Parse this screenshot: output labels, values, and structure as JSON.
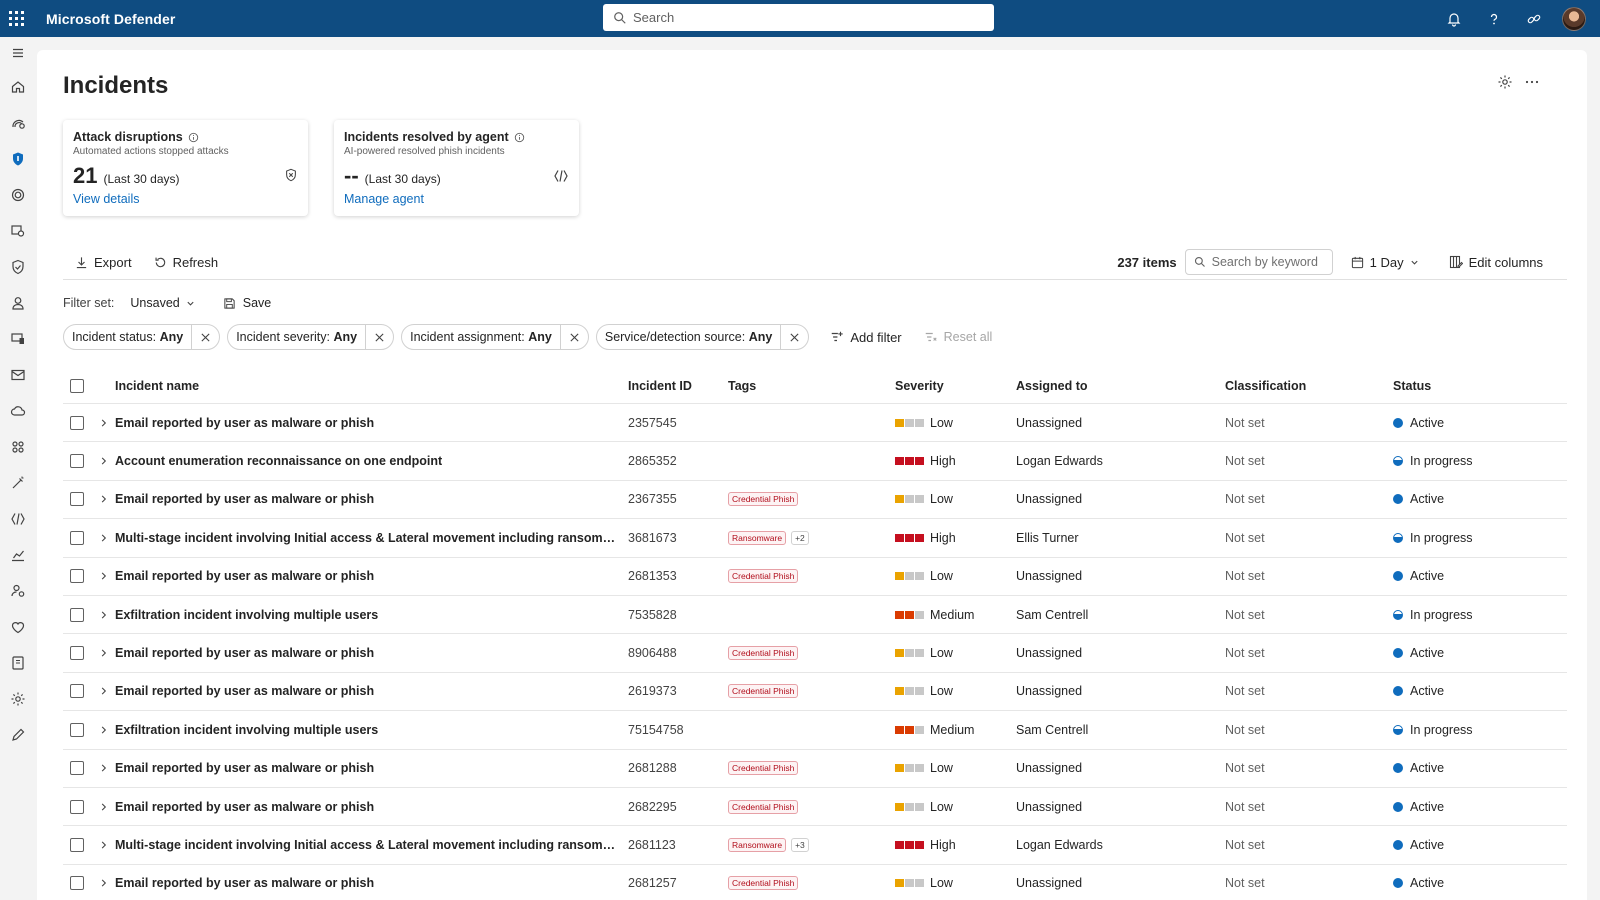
{
  "app": {
    "title": "Microsoft Defender",
    "search_placeholder": "Search"
  },
  "nav_icons": [
    "menu-icon",
    "home-icon",
    "incidents-icon",
    "shield-icon",
    "threat-intel-icon",
    "hunting-icon",
    "protection-icon",
    "identity-icon",
    "endpoint-icon",
    "email-icon",
    "cloud-icon",
    "apps-icon",
    "magic-icon",
    "agent-icon",
    "reports-icon",
    "permissions-icon",
    "health-icon",
    "learning-icon",
    "settings-icon",
    "edit-icon"
  ],
  "page": {
    "title": "Incidents"
  },
  "cards": {
    "attack": {
      "title": "Attack disruptions",
      "subtitle": "Automated actions stopped attacks",
      "value": "21",
      "period": "(Last 30 days)",
      "link": "View details"
    },
    "agent": {
      "title": "Incidents resolved by agent",
      "subtitle": "AI-powered resolved phish incidents",
      "value": "--",
      "period": "(Last 30 days)",
      "link": "Manage agent"
    }
  },
  "toolbar": {
    "export_label": "Export",
    "refresh_label": "Refresh",
    "items_count": "237 items",
    "keyword_placeholder": "Search by keyword",
    "day_label": "1 Day",
    "edit_columns_label": "Edit columns"
  },
  "filterset": {
    "label": "Filter set:",
    "value": "Unsaved",
    "save_label": "Save"
  },
  "filters": [
    {
      "name": "Incident status:",
      "value": "Any"
    },
    {
      "name": "Incident severity:",
      "value": "Any"
    },
    {
      "name": "Incident assignment:",
      "value": "Any"
    },
    {
      "name": "Service/detection source:",
      "value": "Any"
    }
  ],
  "add_filter_label": "Add filter",
  "reset_all_label": "Reset all",
  "table": {
    "columns": {
      "name": "Incident name",
      "id": "Incident ID",
      "tags": "Tags",
      "severity": "Severity",
      "assigned": "Assigned to",
      "classification": "Classification",
      "status": "Status"
    },
    "rows": [
      {
        "name": "Email reported by user as malware or phish",
        "id": "2357545",
        "tag": "",
        "more": "",
        "severity": "Low",
        "assigned": "Unassigned",
        "classification": "Not set",
        "status": "Active"
      },
      {
        "name": "Account enumeration reconnaissance on one endpoint",
        "id": "2865352",
        "tag": "",
        "more": "",
        "severity": "High",
        "assigned": "Logan Edwards",
        "classification": "Not set",
        "status": "In progress"
      },
      {
        "name": "Email reported by user as malware or phish",
        "id": "2367355",
        "tag": "Credential Phish",
        "more": "",
        "severity": "Low",
        "assigned": "Unassigned",
        "classification": "Not set",
        "status": "Active"
      },
      {
        "name": "Multi-stage incident involving Initial access & Lateral movement including ransomware on mu...",
        "id": "3681673",
        "tag": "Ransomware",
        "more": "+2",
        "severity": "High",
        "assigned": "Ellis Turner",
        "classification": "Not set",
        "status": "In progress"
      },
      {
        "name": "Email reported by user as malware or phish",
        "id": "2681353",
        "tag": "Credential Phish",
        "more": "",
        "severity": "Low",
        "assigned": "Unassigned",
        "classification": "Not set",
        "status": "Active"
      },
      {
        "name": "Exfiltration incident involving multiple users",
        "id": "7535828",
        "tag": "",
        "more": "",
        "severity": "Medium",
        "assigned": "Sam Centrell",
        "classification": "Not set",
        "status": "In progress"
      },
      {
        "name": "Email reported by user as malware or phish",
        "id": "8906488",
        "tag": "Credential Phish",
        "more": "",
        "severity": "Low",
        "assigned": "Unassigned",
        "classification": "Not set",
        "status": "Active"
      },
      {
        "name": "Email reported by user as malware or phish",
        "id": "2619373",
        "tag": "Credential Phish",
        "more": "",
        "severity": "Low",
        "assigned": "Unassigned",
        "classification": "Not set",
        "status": "Active"
      },
      {
        "name": "Exfiltration incident involving multiple users",
        "id": "75154758",
        "tag": "",
        "more": "",
        "severity": "Medium",
        "assigned": "Sam Centrell",
        "classification": "Not set",
        "status": "In progress"
      },
      {
        "name": "Email reported by user as malware or phish",
        "id": "2681288",
        "tag": "Credential Phish",
        "more": "",
        "severity": "Low",
        "assigned": "Unassigned",
        "classification": "Not set",
        "status": "Active"
      },
      {
        "name": "Email reported by user as malware or phish",
        "id": "2682295",
        "tag": "Credential Phish",
        "more": "",
        "severity": "Low",
        "assigned": "Unassigned",
        "classification": "Not set",
        "status": "Active"
      },
      {
        "name": "Multi-stage incident involving Initial access & Lateral movement including ransomware on mu...",
        "id": "2681123",
        "tag": "Ransomware",
        "more": "+3",
        "severity": "High",
        "assigned": "Logan Edwards",
        "classification": "Not set",
        "status": "Active"
      },
      {
        "name": "Email reported by user as malware or phish",
        "id": "2681257",
        "tag": "Credential Phish",
        "more": "",
        "severity": "Low",
        "assigned": "Unassigned",
        "classification": "Not set",
        "status": "Active"
      }
    ]
  },
  "colors": {
    "topbar": "#0f4c81",
    "accent": "#0f6cbd",
    "sev_high": "#c50f1f",
    "sev_medium": "#da3b01",
    "sev_low": "#eaa300",
    "sev_off": "#c8c8c8"
  }
}
